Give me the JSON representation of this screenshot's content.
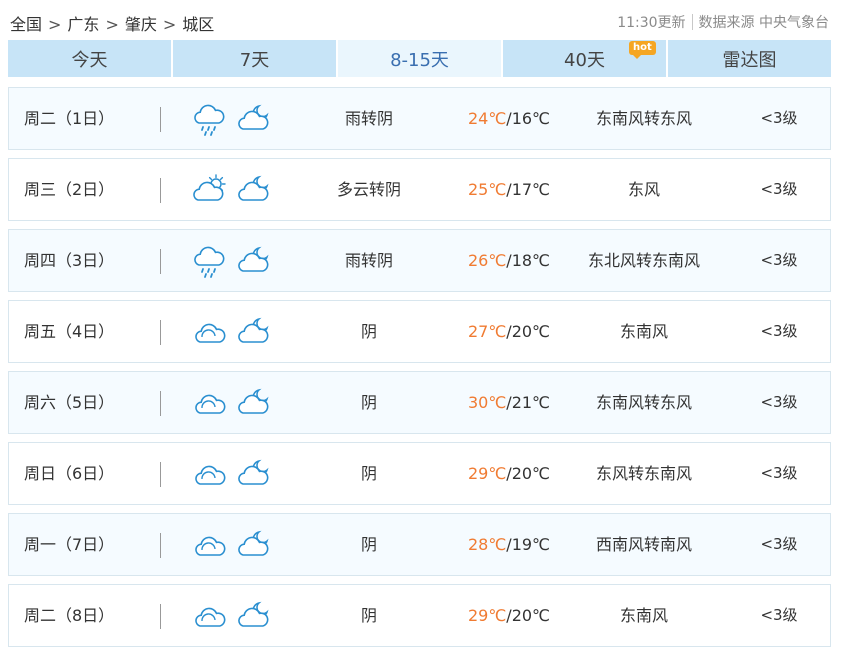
{
  "breadcrumb": [
    "全国",
    "广东",
    "肇庆",
    "城区"
  ],
  "breadcrumb_separator": ">",
  "update_time": "11:30更新",
  "data_source": "数据来源 中央气象台",
  "tabs": [
    {
      "label": "今天"
    },
    {
      "label": "7天"
    },
    {
      "label": "8-15天"
    },
    {
      "label": "40天"
    },
    {
      "label": "雷达图"
    }
  ],
  "active_tab": "8-15天",
  "hot_badge": "hot",
  "colors": {
    "high_temp": "#f07b32",
    "active_tab_text": "#3a6fb0",
    "tab_bg": "#c7e4f7",
    "icon_stroke": "#2a8fd0"
  },
  "forecast": [
    {
      "day": "周二（1日）",
      "icon_day": "rain-cloud-icon",
      "icon_night": "moon-cloud-icon",
      "weather": "雨转阴",
      "high": "24℃",
      "sep": "/",
      "low": "16℃",
      "wind": "东南风转东风",
      "level": "<3级"
    },
    {
      "day": "周三（2日）",
      "icon_day": "sun-cloud-icon",
      "icon_night": "moon-cloud-icon",
      "weather": "多云转阴",
      "high": "25℃",
      "sep": "/",
      "low": "17℃",
      "wind": "东风",
      "level": "<3级"
    },
    {
      "day": "周四（3日）",
      "icon_day": "rain-cloud-icon",
      "icon_night": "moon-cloud-icon",
      "weather": "雨转阴",
      "high": "26℃",
      "sep": "/",
      "low": "18℃",
      "wind": "东北风转东南风",
      "level": "<3级"
    },
    {
      "day": "周五（4日）",
      "icon_day": "cloud-icon",
      "icon_night": "moon-cloud-icon",
      "weather": "阴",
      "high": "27℃",
      "sep": "/",
      "low": "20℃",
      "wind": "东南风",
      "level": "<3级"
    },
    {
      "day": "周六（5日）",
      "icon_day": "cloud-icon",
      "icon_night": "moon-cloud-icon",
      "weather": "阴",
      "high": "30℃",
      "sep": "/",
      "low": "21℃",
      "wind": "东南风转东风",
      "level": "<3级"
    },
    {
      "day": "周日（6日）",
      "icon_day": "cloud-icon",
      "icon_night": "moon-cloud-icon",
      "weather": "阴",
      "high": "29℃",
      "sep": "/",
      "low": "20℃",
      "wind": "东风转东南风",
      "level": "<3级"
    },
    {
      "day": "周一（7日）",
      "icon_day": "cloud-icon",
      "icon_night": "moon-cloud-icon",
      "weather": "阴",
      "high": "28℃",
      "sep": "/",
      "low": "19℃",
      "wind": "西南风转南风",
      "level": "<3级"
    },
    {
      "day": "周二（8日）",
      "icon_day": "cloud-icon",
      "icon_night": "moon-cloud-icon",
      "weather": "阴",
      "high": "29℃",
      "sep": "/",
      "low": "20℃",
      "wind": "东南风",
      "level": "<3级"
    }
  ]
}
